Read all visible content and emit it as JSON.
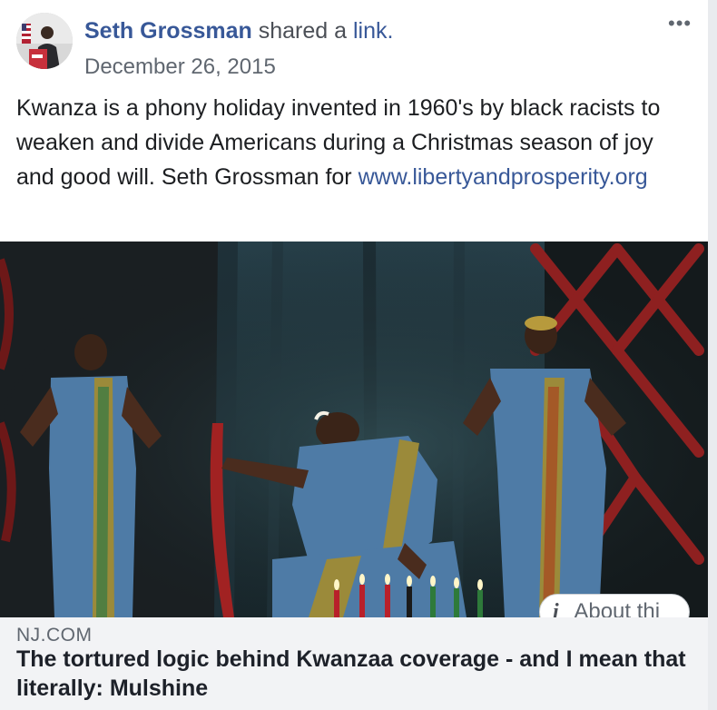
{
  "post": {
    "author": "Seth Grossman",
    "action_prefix": "shared a",
    "action_link": "link.",
    "date": "December 26, 2015",
    "body": "Kwanza is a phony holiday invented in 1960's by black racists to weaken and divide Americans during a Christmas season of joy and good will. Seth Grossman for",
    "body_link": "www.libertyandprosperity.org",
    "more_icon": "•••"
  },
  "link_preview": {
    "about_label": "About thi",
    "info_icon": "i",
    "domain": "NJ.COM",
    "title": "The tortured logic behind Kwanzaa coverage - and I mean that literally: Mulshine"
  },
  "icons": {
    "more": "more-horizontal-icon",
    "info": "info-icon"
  },
  "colors": {
    "link_blue": "#385898",
    "secondary_text": "#606770",
    "preview_bg": "#f2f3f5"
  }
}
